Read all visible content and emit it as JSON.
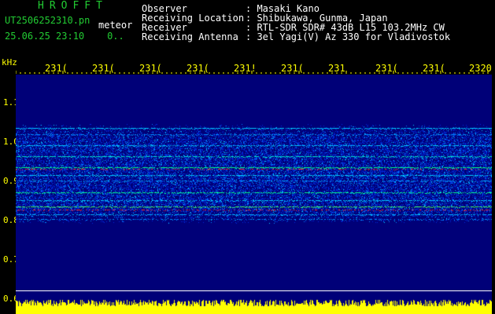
{
  "header": {
    "brand": "HROFFT",
    "file_name": "UT2506252310.pn",
    "file_suffix": "meteor",
    "date_time": "25.06.25 23:10",
    "counter": "0.."
  },
  "metadata": {
    "labels": [
      "Observer",
      "Receiving Location",
      "Receiver",
      "Receiving Antenna"
    ],
    "values": [
      ": Masaki Kano",
      ": Shibukawa, Gunma, Japan",
      ": RTL-SDR SDR# 43dB L15 103.2MHz CW",
      ": 3el Yagi(V) Az 330 for Vladivostok"
    ]
  },
  "time_axis": {
    "ticks": [
      "231(",
      "231(",
      "231(",
      "231(",
      "231!",
      "231(",
      "231",
      "231(",
      "231(",
      "2320"
    ]
  },
  "freq_axis": {
    "unit": "kHz",
    "ticks": [
      "1.1",
      "1.0",
      "0.9",
      "0.8",
      "0.7",
      "0.6"
    ]
  },
  "colors": {
    "text_header": "#22cc33",
    "text_meta": "#ffffff",
    "axis": "#ffff00",
    "background": "#000000"
  }
}
